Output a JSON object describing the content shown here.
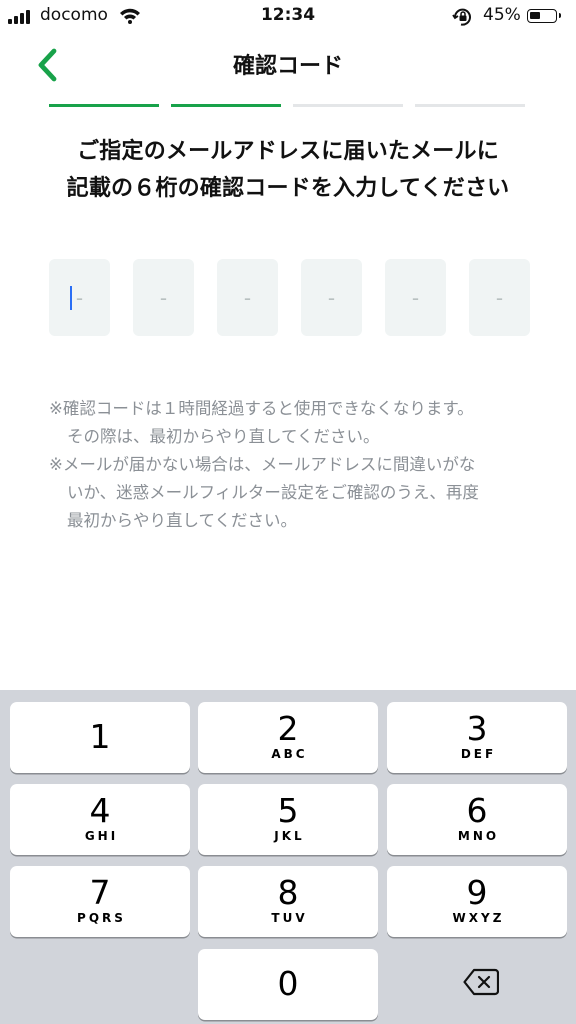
{
  "status_bar": {
    "carrier": "docomo",
    "time": "12:34",
    "battery_percent": "45%",
    "battery_level": 0.45
  },
  "nav": {
    "title": "確認コード"
  },
  "progress": {
    "total_steps": 4,
    "current_step": 2
  },
  "heading": {
    "line1": "ご指定のメールアドレスに届いたメールに",
    "line2": "記載の６桁の確認コードを入力してください"
  },
  "code_input": {
    "placeholders": [
      "-",
      "-",
      "-",
      "-",
      "-",
      "-"
    ],
    "value": ""
  },
  "notes": {
    "note1_line1": "※確認コードは１時間経過すると使用できなくなります。",
    "note1_line2": "その際は、最初からやり直してください。",
    "note2_line1": "※メールが届かない場合は、メールアドレスに間違いがな",
    "note2_line2": "いか、迷惑メールフィルター設定をご確認のうえ、再度",
    "note2_line3": "最初からやり直してください。"
  },
  "keypad": {
    "keys": [
      {
        "digit": "1",
        "letters": ""
      },
      {
        "digit": "2",
        "letters": "ABC"
      },
      {
        "digit": "3",
        "letters": "DEF"
      },
      {
        "digit": "4",
        "letters": "GHI"
      },
      {
        "digit": "5",
        "letters": "JKL"
      },
      {
        "digit": "6",
        "letters": "MNO"
      },
      {
        "digit": "7",
        "letters": "PQRS"
      },
      {
        "digit": "8",
        "letters": "TUV"
      },
      {
        "digit": "9",
        "letters": "WXYZ"
      },
      {
        "digit": "0",
        "letters": ""
      }
    ],
    "delete_icon": "backspace-icon"
  },
  "colors": {
    "accent_green": "#18a24a",
    "caret_blue": "#2a6ef5",
    "note_gray": "#8b9096",
    "keyboard_bg": "#d1d4da"
  }
}
